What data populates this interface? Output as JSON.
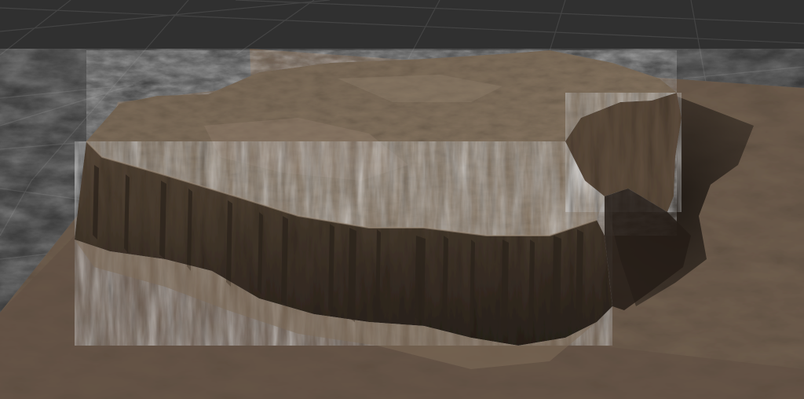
{
  "scene": {
    "view": "perspective-3d-viewport",
    "object": "terrain-mesa",
    "colors": {
      "viewport_background": "#303030",
      "grid_line": "#444444",
      "ground_base": "#6e5d4d",
      "ground_dark": "#4f4134",
      "ground_light": "#8e7a66",
      "plateau_top": "#776755",
      "plateau_top_light": "#8a7864",
      "cliff_face": "#5a4a3a",
      "cliff_shadow": "#2a221b",
      "cast_shadow": "#2c241d"
    }
  }
}
